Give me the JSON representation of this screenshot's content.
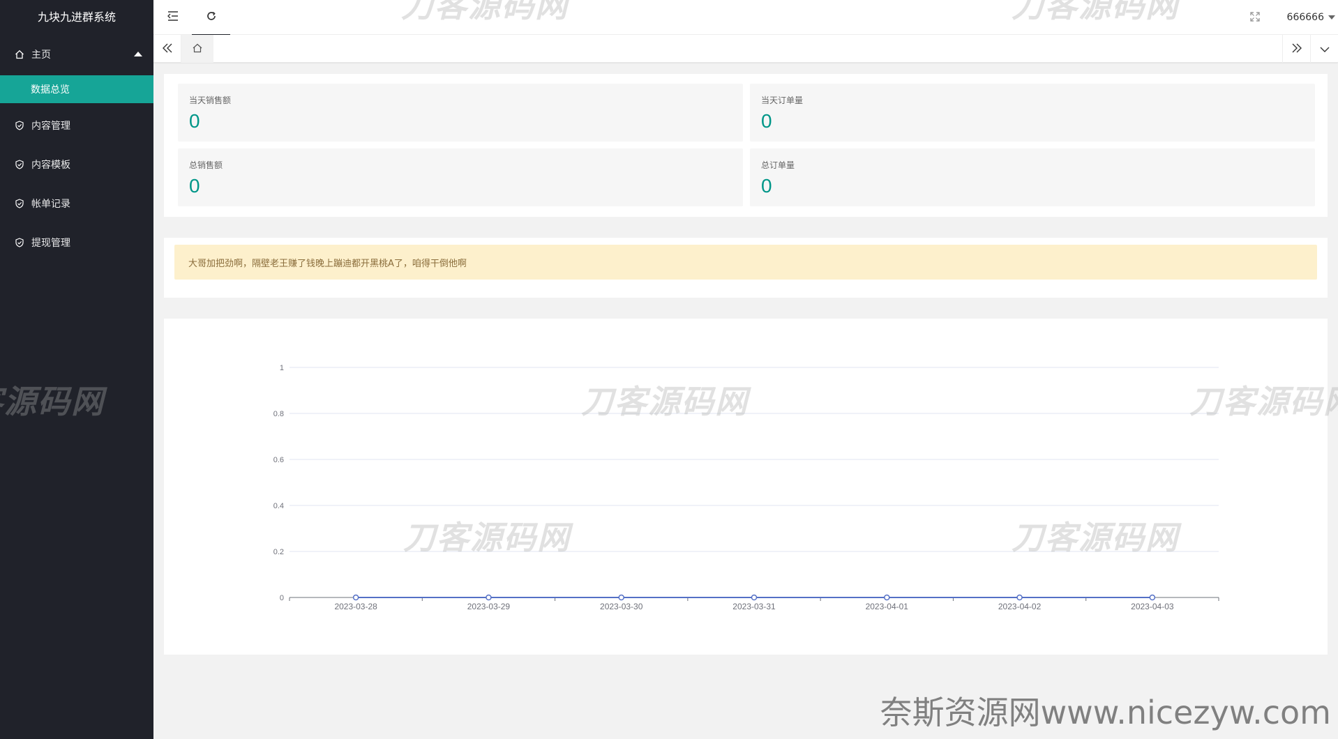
{
  "app": {
    "title": "九块九进群系统"
  },
  "sidebar": {
    "home": {
      "label": "主页",
      "sub": "数据总览"
    },
    "items": [
      {
        "label": "内容管理"
      },
      {
        "label": "内容模板"
      },
      {
        "label": "帐单记录"
      },
      {
        "label": "提现管理"
      }
    ]
  },
  "header": {
    "user": "666666"
  },
  "stats": [
    {
      "label": "当天销售额",
      "value": "0"
    },
    {
      "label": "当天订单量",
      "value": "0"
    },
    {
      "label": "总销售额",
      "value": "0"
    },
    {
      "label": "总订单量",
      "value": "0"
    }
  ],
  "notice": {
    "text": "大哥加把劲啊，隔壁老王赚了钱晚上蹦迪都开黑桃A了，咱得干倒他啊"
  },
  "colors": {
    "sidebar": "#20222a",
    "accent": "#16a597",
    "value": "#009688",
    "notice_bg": "#fdf0cc",
    "series": "#5470c6"
  },
  "icons": {
    "menu": "menu-fold-icon",
    "refresh": "refresh-icon",
    "fullscreen": "fullscreen-icon",
    "home": "home-icon",
    "item": "shield-check-icon"
  },
  "watermark": {
    "text": "刀客源码网"
  },
  "site_mark": {
    "text": "奈斯资源网www.nicezyw.com"
  },
  "chart_data": {
    "type": "line",
    "title": "",
    "xlabel": "",
    "ylabel": "",
    "categories": [
      "2023-03-28",
      "2023-03-29",
      "2023-03-30",
      "2023-03-31",
      "2023-04-01",
      "2023-04-02",
      "2023-04-03"
    ],
    "series": [
      {
        "values": [
          0,
          0,
          0,
          0,
          0,
          0,
          0
        ]
      }
    ],
    "ylim": [
      0,
      1
    ],
    "yticks": [
      "0",
      "0.2",
      "0.4",
      "0.6",
      "0.8",
      "1"
    ],
    "grid": true
  }
}
